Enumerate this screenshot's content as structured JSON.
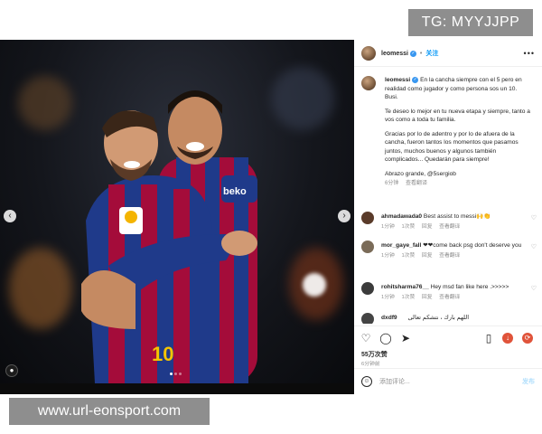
{
  "watermarks": {
    "telegram": "TG: MYYJJPP",
    "site": "www.url-eonsport.com"
  },
  "post": {
    "username": "leomessi",
    "follow_label": "关注",
    "more_label": "•••",
    "caption": {
      "username": "leomessi",
      "paragraphs": [
        "En la cancha siempre con el 5 pero en realidad como jugador y como persona sos un 10. Busi.",
        "Te deseo lo mejor en tu nueva etapa y siempre, tanto a vos como a toda tu familia.",
        "Gracias por lo de adentro y por lo de afuera de la cancha, fueron tantos los momentos que pasamos juntos, muchos buenos y algunos también complicados... Quedarán para siempre!",
        "Abrazo grande, @5sergiob"
      ],
      "time": "6分钟",
      "translate": "查看翻译"
    },
    "comments": [
      {
        "username": "ahmadawada0",
        "text": "Best assist to messi🙌👏",
        "time": "1分钟",
        "likes": "1次赞",
        "reply": "回复",
        "translate": "查看翻译",
        "avatar_color": "#5a3b2a"
      },
      {
        "username": "mor_gaye_fall",
        "text": "❤❤come back psg don't deserve you",
        "time": "1分钟",
        "likes": "1次赞",
        "reply": "回复",
        "translate": "查看翻译",
        "avatar_color": "#7a6b58"
      },
      {
        "username": "rohitsharma76__",
        "text": "Hey msd fan like here .>>>>>",
        "time": "1分钟",
        "likes": "1次赞",
        "reply": "回复",
        "translate": "查看翻译",
        "avatar_color": "#3b3b3b"
      },
      {
        "username": "dxdf9",
        "text": "اللهم بارك ، نتشكم تعالى",
        "avatar_color": "#444444"
      }
    ],
    "likes_count": "55万次赞",
    "posted_time": "6分钟前",
    "comment_placeholder": "添加评论...",
    "post_label": "发布"
  },
  "icons": {
    "heart": "heart-icon",
    "comment": "comment-icon",
    "share": "share-icon",
    "save": "bookmark-icon"
  },
  "colors": {
    "accent": "#0095f6",
    "verified": "#3897f0",
    "muted": "#8e8e8e",
    "watermark_bg": "#8e8e8e"
  }
}
